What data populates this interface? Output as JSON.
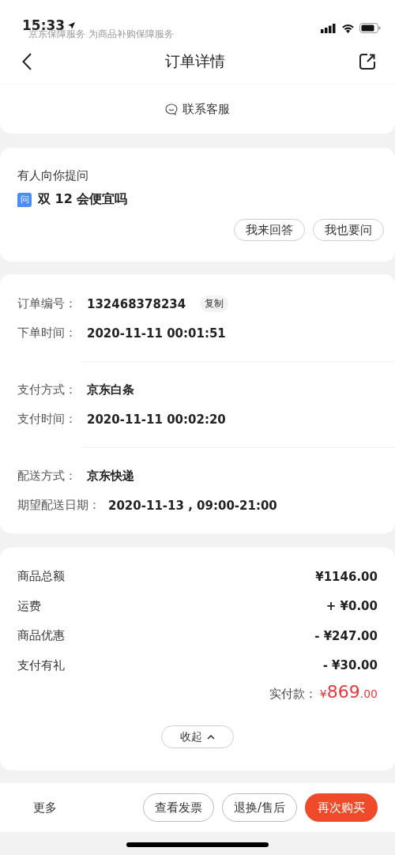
{
  "status_bar": {
    "time": "15:33"
  },
  "banner": {
    "text": "京东保障服务  为商品补购保障服务"
  },
  "nav": {
    "title": "订单详情"
  },
  "contact": {
    "label": "联系客服"
  },
  "question": {
    "heading": "有人向你提问",
    "badge": "问",
    "text": "双 12 会便宜吗",
    "buttons": [
      "我来回答",
      "我也要问"
    ]
  },
  "order_info": {
    "groups": [
      {
        "rows": [
          {
            "label": "订单编号：",
            "value": "132468378234",
            "action": "复制"
          },
          {
            "label": "下单时间：",
            "value": "2020-11-11 00:01:51"
          }
        ]
      },
      {
        "rows": [
          {
            "label": "支付方式：",
            "value": "京东白条"
          },
          {
            "label": "支付时间：",
            "value": "2020-11-11 00:02:20"
          }
        ]
      },
      {
        "rows": [
          {
            "label": "配送方式：",
            "value": "京东快递"
          },
          {
            "label": "期望配送日期：",
            "value": "2020-11-13 , 09:00-21:00"
          }
        ]
      }
    ]
  },
  "price": {
    "rows": [
      {
        "label": "商品总额",
        "value": "¥1146.00"
      },
      {
        "label": "运费",
        "value": "+ ¥0.00"
      },
      {
        "label": "商品优惠",
        "value": "- ¥247.00"
      },
      {
        "label": "支付有礼",
        "value": "- ¥30.00"
      }
    ],
    "total": {
      "label": "实付款：",
      "currency": "¥",
      "integer": "869",
      "decimal": ".00"
    },
    "collapse": "收起"
  },
  "bottom_bar": {
    "more": "更多",
    "buttons": [
      {
        "label": "查看发票",
        "kind": "outline"
      },
      {
        "label": "退换/售后",
        "kind": "outline"
      },
      {
        "label": "再次购买",
        "kind": "primary"
      }
    ]
  }
}
